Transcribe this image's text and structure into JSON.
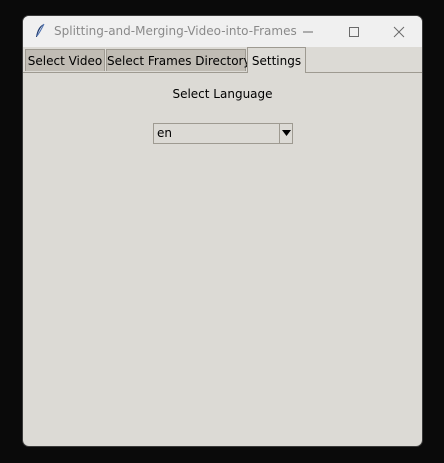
{
  "window": {
    "title": "Splitting-and-Merging-Video-into-Frames",
    "icons": {
      "app": "feather-icon",
      "minimize": "minimize-icon",
      "maximize": "maximize-icon",
      "close": "close-icon"
    }
  },
  "tabs": [
    {
      "label": "Select Video",
      "selected": false
    },
    {
      "label": "Select Frames Directory",
      "selected": false
    },
    {
      "label": "Settings",
      "selected": true
    }
  ],
  "settings": {
    "language_label": "Select Language",
    "language_value": "en",
    "dropdown_icon": "chevron-down-icon"
  },
  "colors": {
    "window_bg": "#dcdad5",
    "tab_bg": "#c0bcb4",
    "titlebar_bg": "#f0f0f0",
    "screen_bg": "#0a0a0a"
  }
}
